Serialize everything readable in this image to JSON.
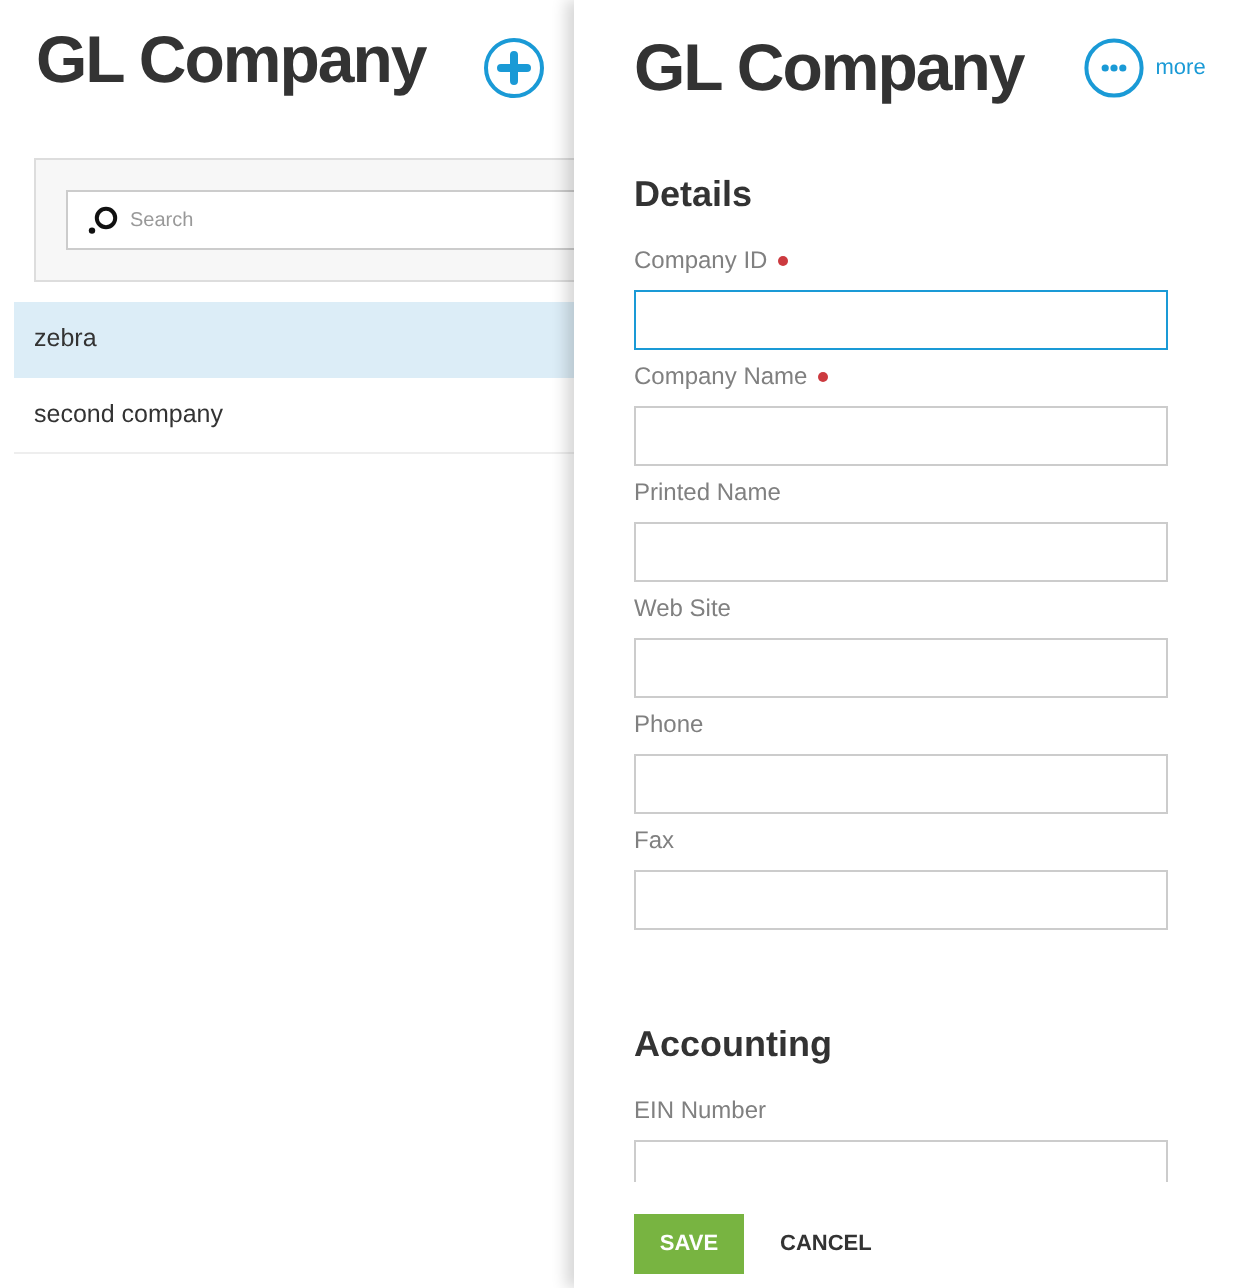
{
  "list_panel": {
    "title": "GL Company",
    "search": {
      "placeholder": "Search"
    },
    "items": [
      {
        "label": "zebra",
        "selected": true
      },
      {
        "label": "second company",
        "selected": false
      }
    ]
  },
  "detail_panel": {
    "title": "GL Company",
    "more_label": "more",
    "sections": [
      {
        "heading": "Details",
        "fields": [
          {
            "label": "Company ID",
            "required": true,
            "focused": true
          },
          {
            "label": "Company Name",
            "required": true,
            "focused": false
          },
          {
            "label": "Printed Name",
            "required": false,
            "focused": false
          },
          {
            "label": "Web Site",
            "required": false,
            "focused": false
          },
          {
            "label": "Phone",
            "required": false,
            "focused": false
          },
          {
            "label": "Fax",
            "required": false,
            "focused": false
          }
        ]
      },
      {
        "heading": "Accounting",
        "fields": [
          {
            "label": "EIN Number",
            "required": false,
            "focused": false
          }
        ]
      }
    ],
    "buttons": [
      {
        "label": "SAVE",
        "kind": "primary"
      },
      {
        "label": "CANCEL",
        "kind": "secondary"
      }
    ]
  }
}
